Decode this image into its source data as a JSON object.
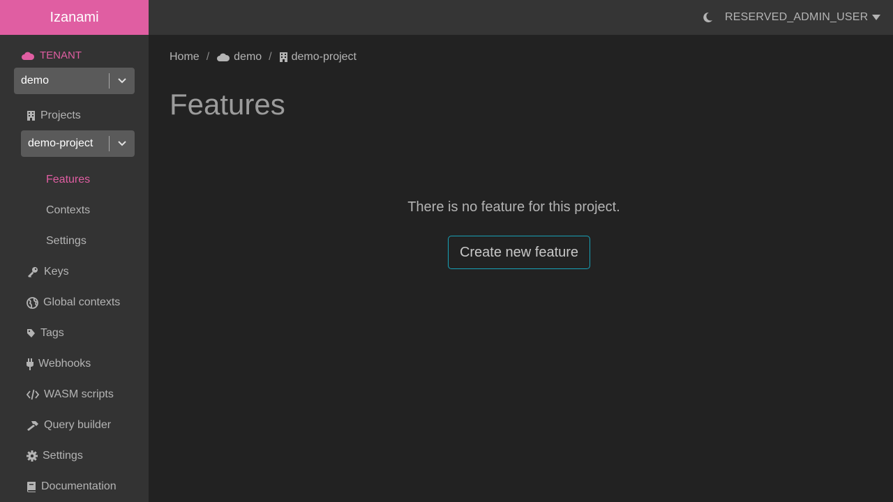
{
  "brand": {
    "name": "Izanami"
  },
  "topbar": {
    "user": "RESERVED_ADMIN_USER"
  },
  "sidebar": {
    "tenant_label": "TENANT",
    "tenant_select": "demo",
    "projects_label": "Projects",
    "project_select": "demo-project",
    "project_sub": [
      {
        "label": "Features",
        "active": true
      },
      {
        "label": "Contexts",
        "active": false
      },
      {
        "label": "Settings",
        "active": false
      }
    ],
    "items": [
      {
        "label": "Keys",
        "icon": "key-icon"
      },
      {
        "label": "Global contexts",
        "icon": "globe-icon"
      },
      {
        "label": "Tags",
        "icon": "tag-icon"
      },
      {
        "label": "Webhooks",
        "icon": "plug-icon"
      },
      {
        "label": "WASM scripts",
        "icon": "code-icon"
      },
      {
        "label": "Query builder",
        "icon": "hammer-icon"
      },
      {
        "label": "Settings",
        "icon": "gear-icon"
      },
      {
        "label": "Documentation",
        "icon": "book-icon"
      }
    ]
  },
  "breadcrumb": {
    "home": "Home",
    "tenant": "demo",
    "project": "demo-project"
  },
  "main": {
    "title": "Features",
    "empty_message": "There is no feature for this project.",
    "create_button": "Create new feature"
  },
  "colors": {
    "accent": "#e05ea2",
    "button_border": "#17a2b8",
    "background": "#222222",
    "sidebar": "#333333"
  }
}
